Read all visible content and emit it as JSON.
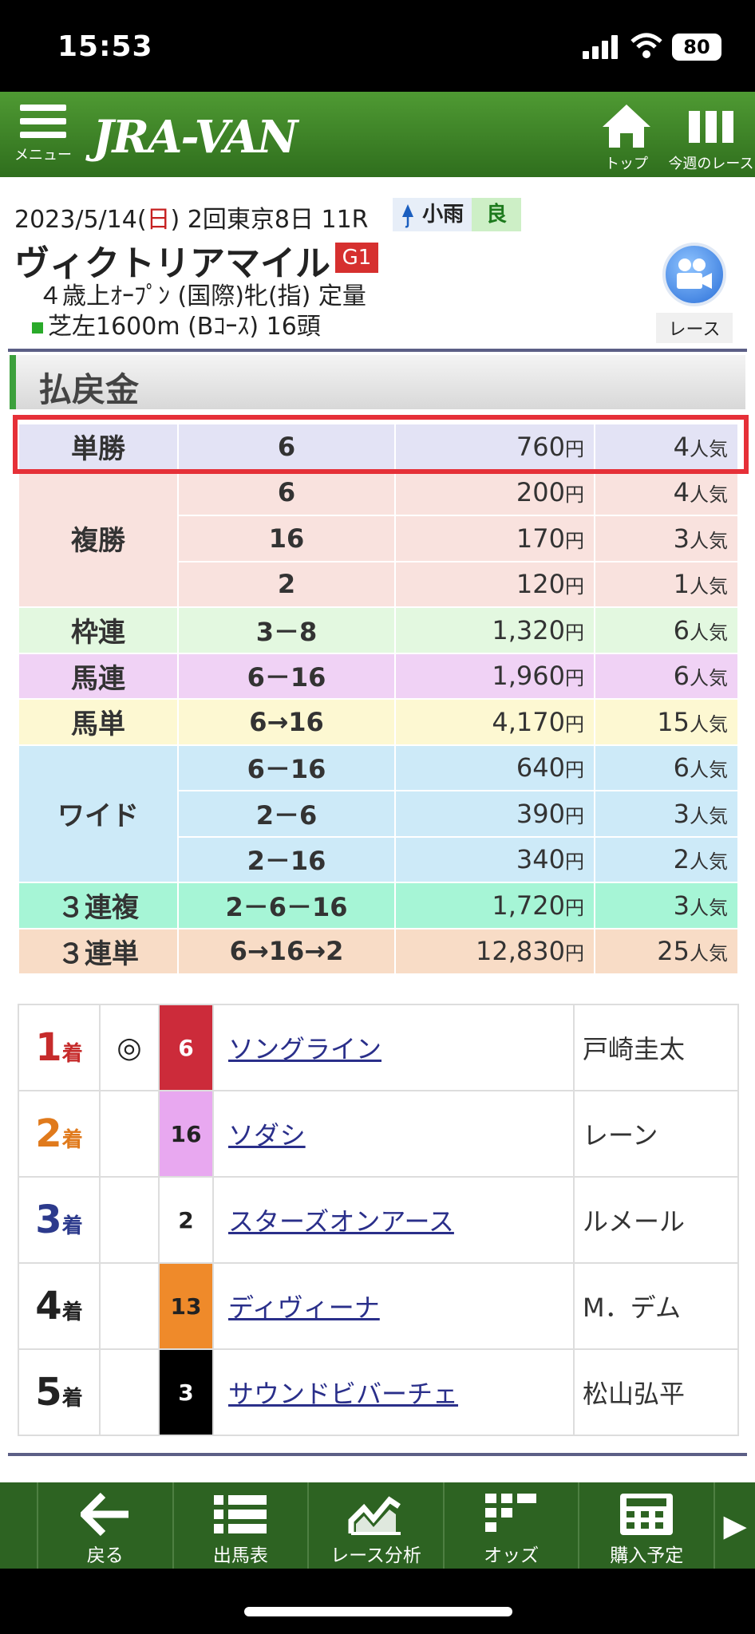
{
  "status": {
    "time": "15:53",
    "battery": "80"
  },
  "header": {
    "menu_label": "メニュー",
    "logo": "JRA-VAN",
    "top_label": "トップ",
    "week_label": "今週のレース"
  },
  "race": {
    "date": "2023/5/14(",
    "weekday": "日",
    "date_rest": ") 2回東京8日 11R",
    "weather": "小雨",
    "going": "良",
    "name": "ヴィクトリアマイル",
    "grade": "G1",
    "condition": "４歳上ｵｰﾌﾟﾝ (国際)牝(指) 定量",
    "course": "芝左1600m (Bｺｰｽ) 16頭",
    "video_label": "レース"
  },
  "payout": {
    "title": "払戻金",
    "yen": "円",
    "pop_suffix": "人気",
    "rows": [
      {
        "type": "単勝",
        "bg": "#e3e3f5",
        "entries": [
          {
            "num": "6",
            "amount": "760",
            "pop": "4"
          }
        ]
      },
      {
        "type": "複勝",
        "bg": "#f9e2de",
        "entries": [
          {
            "num": "6",
            "amount": "200",
            "pop": "4"
          },
          {
            "num": "16",
            "amount": "170",
            "pop": "3"
          },
          {
            "num": "2",
            "amount": "120",
            "pop": "1"
          }
        ]
      },
      {
        "type": "枠連",
        "bg": "#e3f8e0",
        "entries": [
          {
            "num": "3－8",
            "amount": "1,320",
            "pop": "6"
          }
        ]
      },
      {
        "type": "馬連",
        "bg": "#f0d2f5",
        "entries": [
          {
            "num": "6－16",
            "amount": "1,960",
            "pop": "6"
          }
        ]
      },
      {
        "type": "馬単",
        "bg": "#fdf8d2",
        "entries": [
          {
            "num": "6→16",
            "amount": "4,170",
            "pop": "15"
          }
        ]
      },
      {
        "type": "ワイド",
        "bg": "#cdeaf8",
        "entries": [
          {
            "num": "6－16",
            "amount": "640",
            "pop": "6"
          },
          {
            "num": "2－6",
            "amount": "390",
            "pop": "3"
          },
          {
            "num": "2－16",
            "amount": "340",
            "pop": "2"
          }
        ]
      },
      {
        "type": "３連複",
        "bg": "#a6f5d6",
        "entries": [
          {
            "num": "2－6－16",
            "amount": "1,720",
            "pop": "3"
          }
        ]
      },
      {
        "type": "３連単",
        "bg": "#f8dcc6",
        "entries": [
          {
            "num": "6→16→2",
            "amount": "12,830",
            "pop": "25"
          }
        ]
      }
    ]
  },
  "results": {
    "place_suffix": "着",
    "rows": [
      {
        "rank": "1",
        "rank_color": "#c62b2b",
        "mark": "◎",
        "num": "6",
        "num_bg": "#cc2b3a",
        "num_fg": "#ffffff",
        "horse": "ソングライン",
        "jockey": "戸崎圭太"
      },
      {
        "rank": "2",
        "rank_color": "#e07a1c",
        "mark": "",
        "num": "16",
        "num_bg": "#e8a8f0",
        "num_fg": "#222222",
        "horse": "ソダシ",
        "jockey": "レーン"
      },
      {
        "rank": "3",
        "rank_color": "#2c3a8c",
        "mark": "",
        "num": "2",
        "num_bg": "#ffffff",
        "num_fg": "#222222",
        "horse": "スターズオンアース",
        "jockey": "ルメール"
      },
      {
        "rank": "4",
        "rank_color": "#222222",
        "mark": "",
        "num": "13",
        "num_bg": "#ef8a2a",
        "num_fg": "#222222",
        "horse": "ディヴィーナ",
        "jockey": "M．デム"
      },
      {
        "rank": "5",
        "rank_color": "#222222",
        "mark": "",
        "num": "3",
        "num_bg": "#000000",
        "num_fg": "#ffffff",
        "horse": "サウンドビバーチェ",
        "jockey": "松山弘平"
      }
    ]
  },
  "bottom_nav": [
    {
      "label": "戻る",
      "icon": "back-arrow-icon"
    },
    {
      "label": "出馬表",
      "icon": "list-icon"
    },
    {
      "label": "レース分析",
      "icon": "chart-icon"
    },
    {
      "label": "オッズ",
      "icon": "odds-grid-icon"
    },
    {
      "label": "購入予定",
      "icon": "calculator-icon"
    }
  ]
}
